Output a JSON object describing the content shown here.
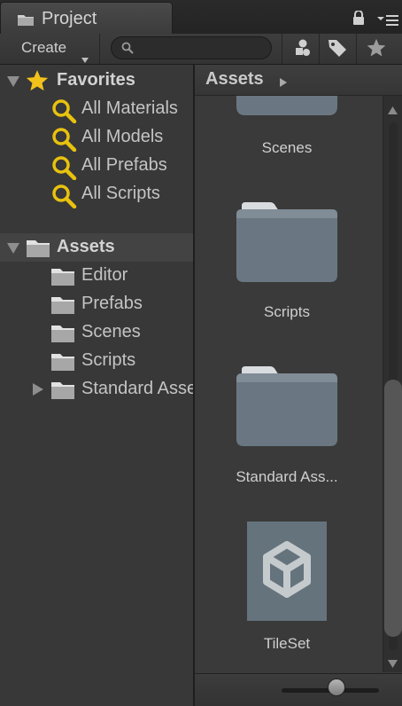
{
  "window": {
    "tab_title": "Project"
  },
  "toolbar": {
    "create_label": "Create",
    "search_placeholder": ""
  },
  "tree": {
    "favorites_label": "Favorites",
    "favorites": [
      "All Materials",
      "All Models",
      "All Prefabs",
      "All Scripts"
    ],
    "assets_label": "Assets",
    "asset_folders": [
      "Editor",
      "Prefabs",
      "Scenes",
      "Scripts",
      "Standard Assets"
    ]
  },
  "browser": {
    "breadcrumb": "Assets",
    "items": [
      {
        "label": "Scenes",
        "kind": "folder"
      },
      {
        "label": "Scripts",
        "kind": "folder"
      },
      {
        "label": "Standard Ass...",
        "kind": "folder"
      },
      {
        "label": "TileSet",
        "kind": "unity-asset"
      }
    ]
  },
  "colors": {
    "favorite_star": "#f2c21b",
    "search_glass": "#e8c20e",
    "folder_body": "#6a7782",
    "folder_tab": "#d9dcdf",
    "unity_tile": "#65737d"
  },
  "icons": [
    "folder-icon",
    "lock-icon",
    "menu-icon",
    "search-icon",
    "filter-by-type-icon",
    "filter-by-label-icon",
    "favorite-icon",
    "star-icon",
    "magnifier-icon",
    "unity-logo-icon"
  ]
}
